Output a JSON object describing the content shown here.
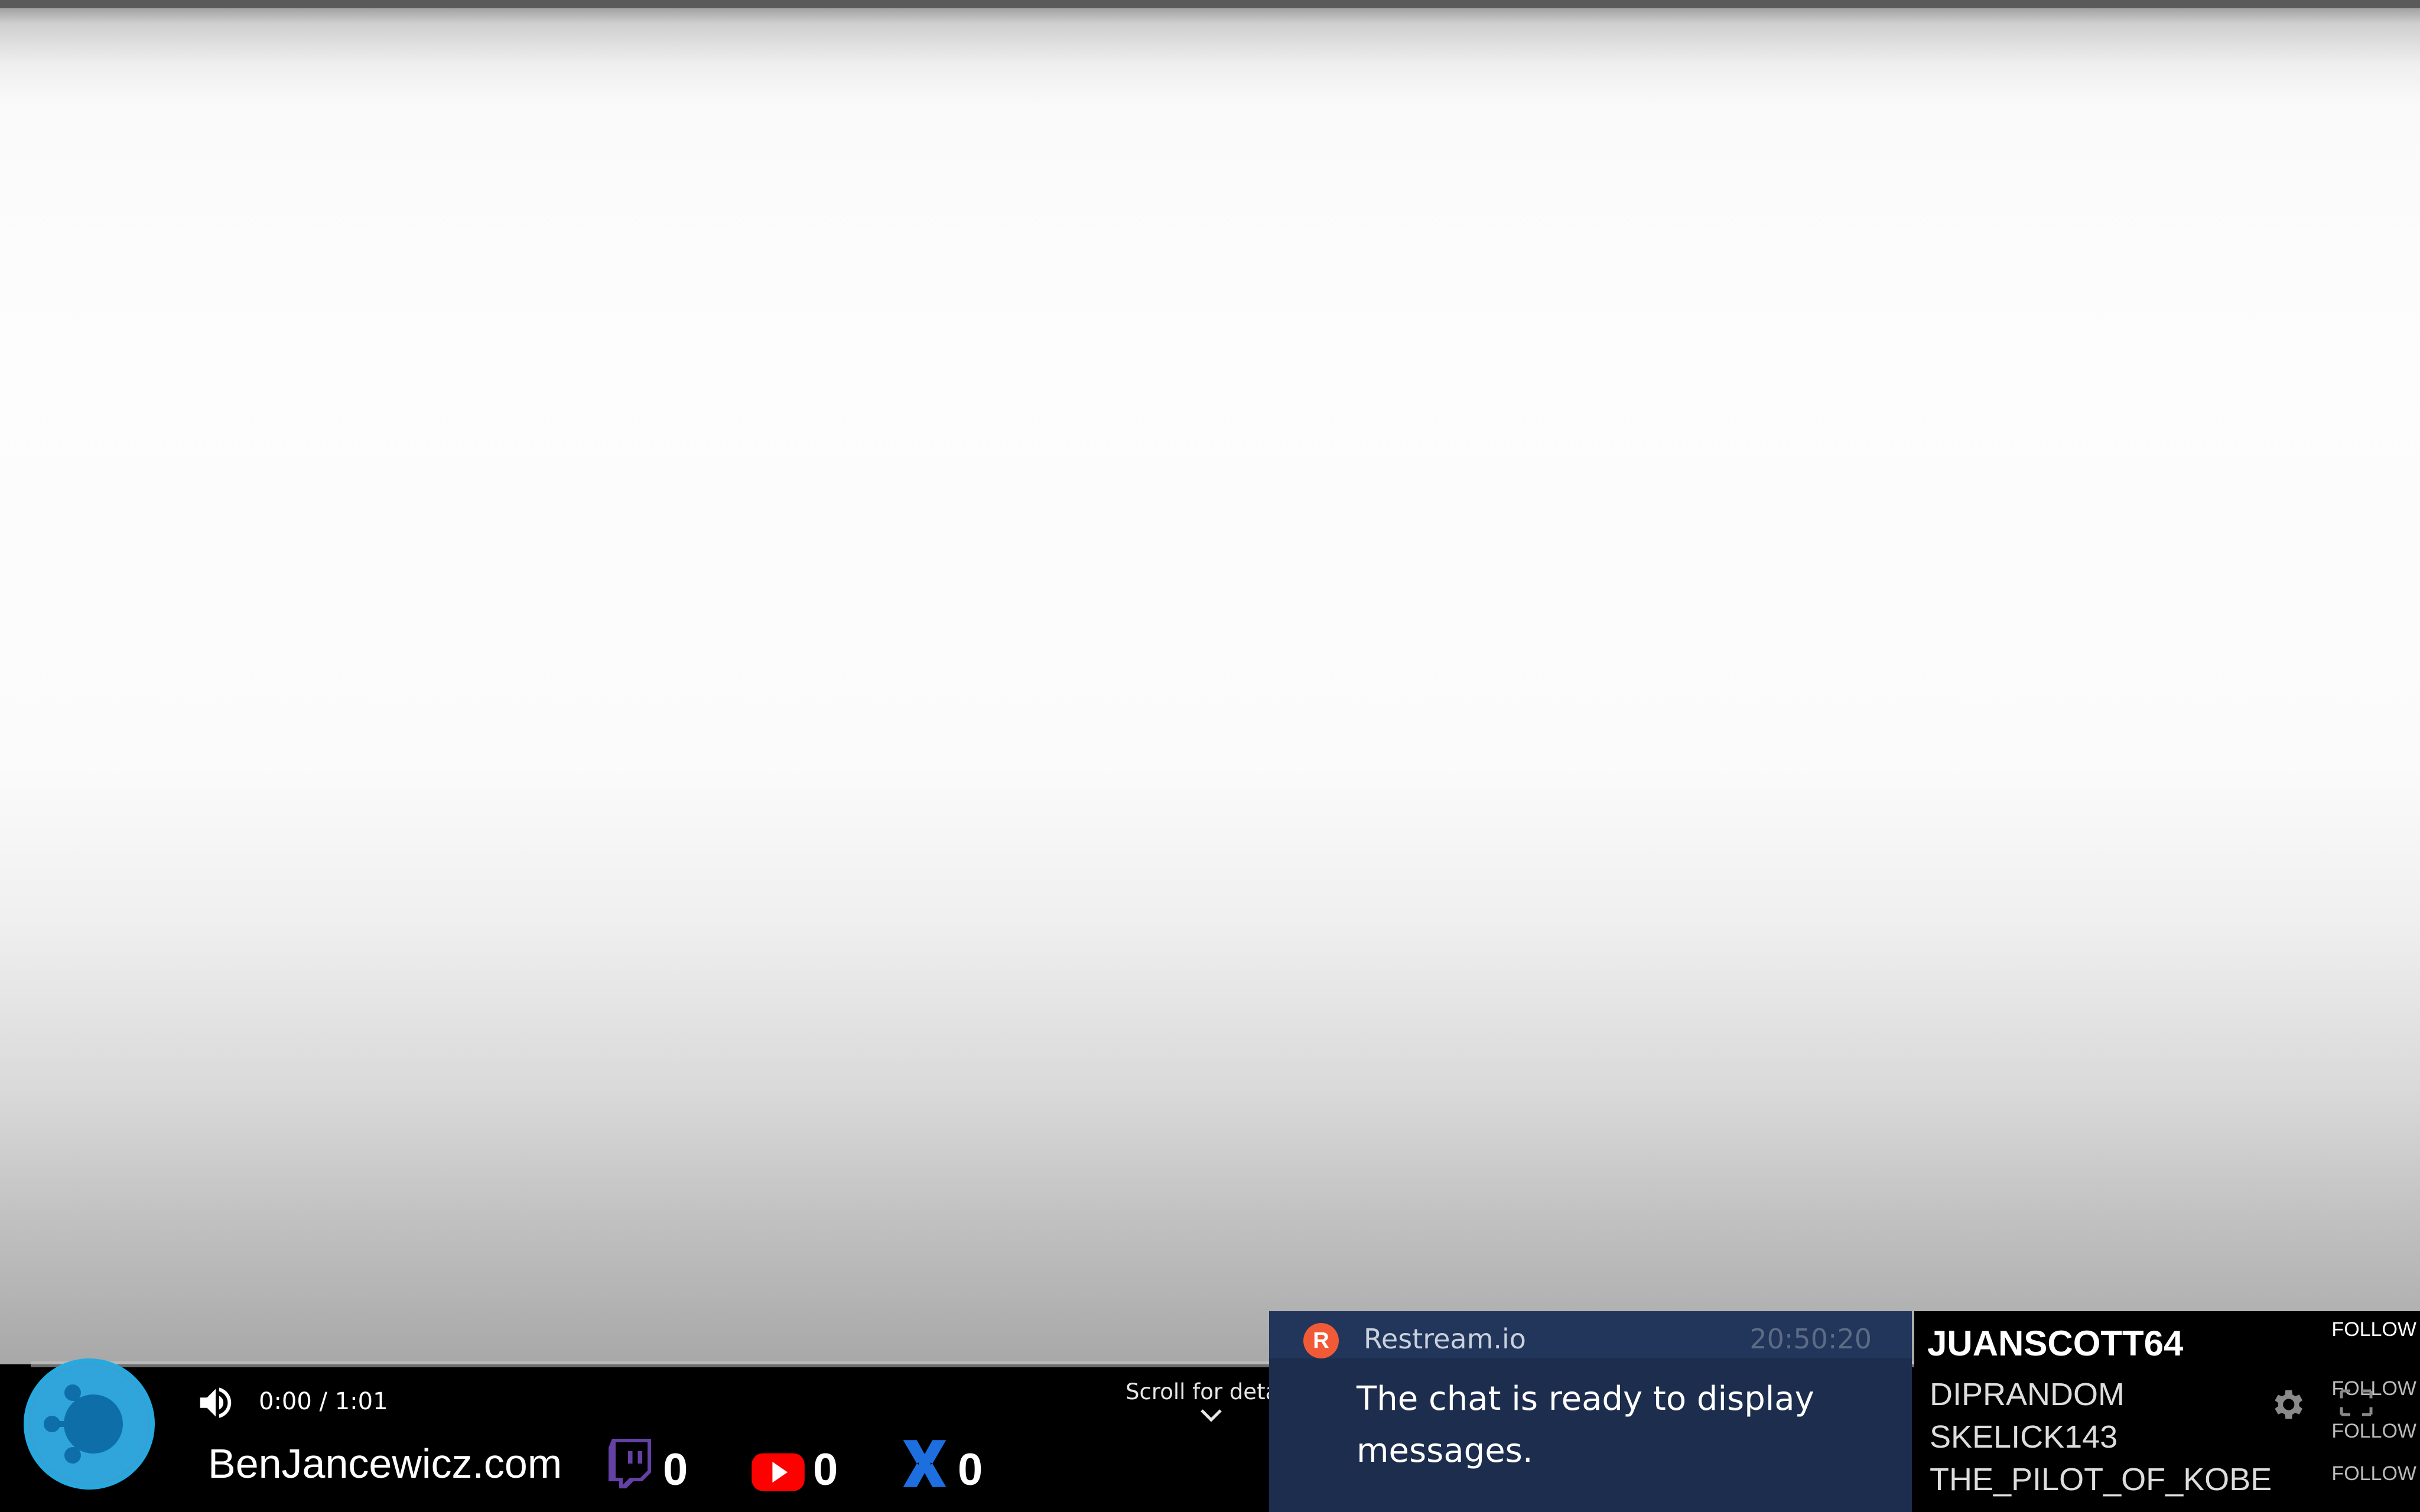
{
  "player": {
    "current_time": "0:00",
    "duration": "1:01",
    "time_text": "0:00 / 1:01",
    "progress_fraction": 0,
    "scroll_hint": "Scroll for details"
  },
  "overlay": {
    "site": "BenJancewicz.com",
    "stats": [
      {
        "platform": "twitch",
        "icon": "twitch-icon",
        "count": "0",
        "color": "#6441a5"
      },
      {
        "platform": "youtube",
        "icon": "youtube-icon",
        "count": "0",
        "color": "#ff0000"
      },
      {
        "platform": "x",
        "icon": "x-icon",
        "count": "0",
        "color": "#1d6fe0"
      }
    ]
  },
  "chat": {
    "source": "Restream.io",
    "logo_letter": "R",
    "time": "20:50:20",
    "message": "The chat is ready to display messages."
  },
  "followers": {
    "top_name": "JUANSCOTT64",
    "names": [
      "DIPRANDOM",
      "SKELICK143",
      "THE_PILOT_OF_KOBE"
    ],
    "follow_label": "FOLLOW"
  }
}
